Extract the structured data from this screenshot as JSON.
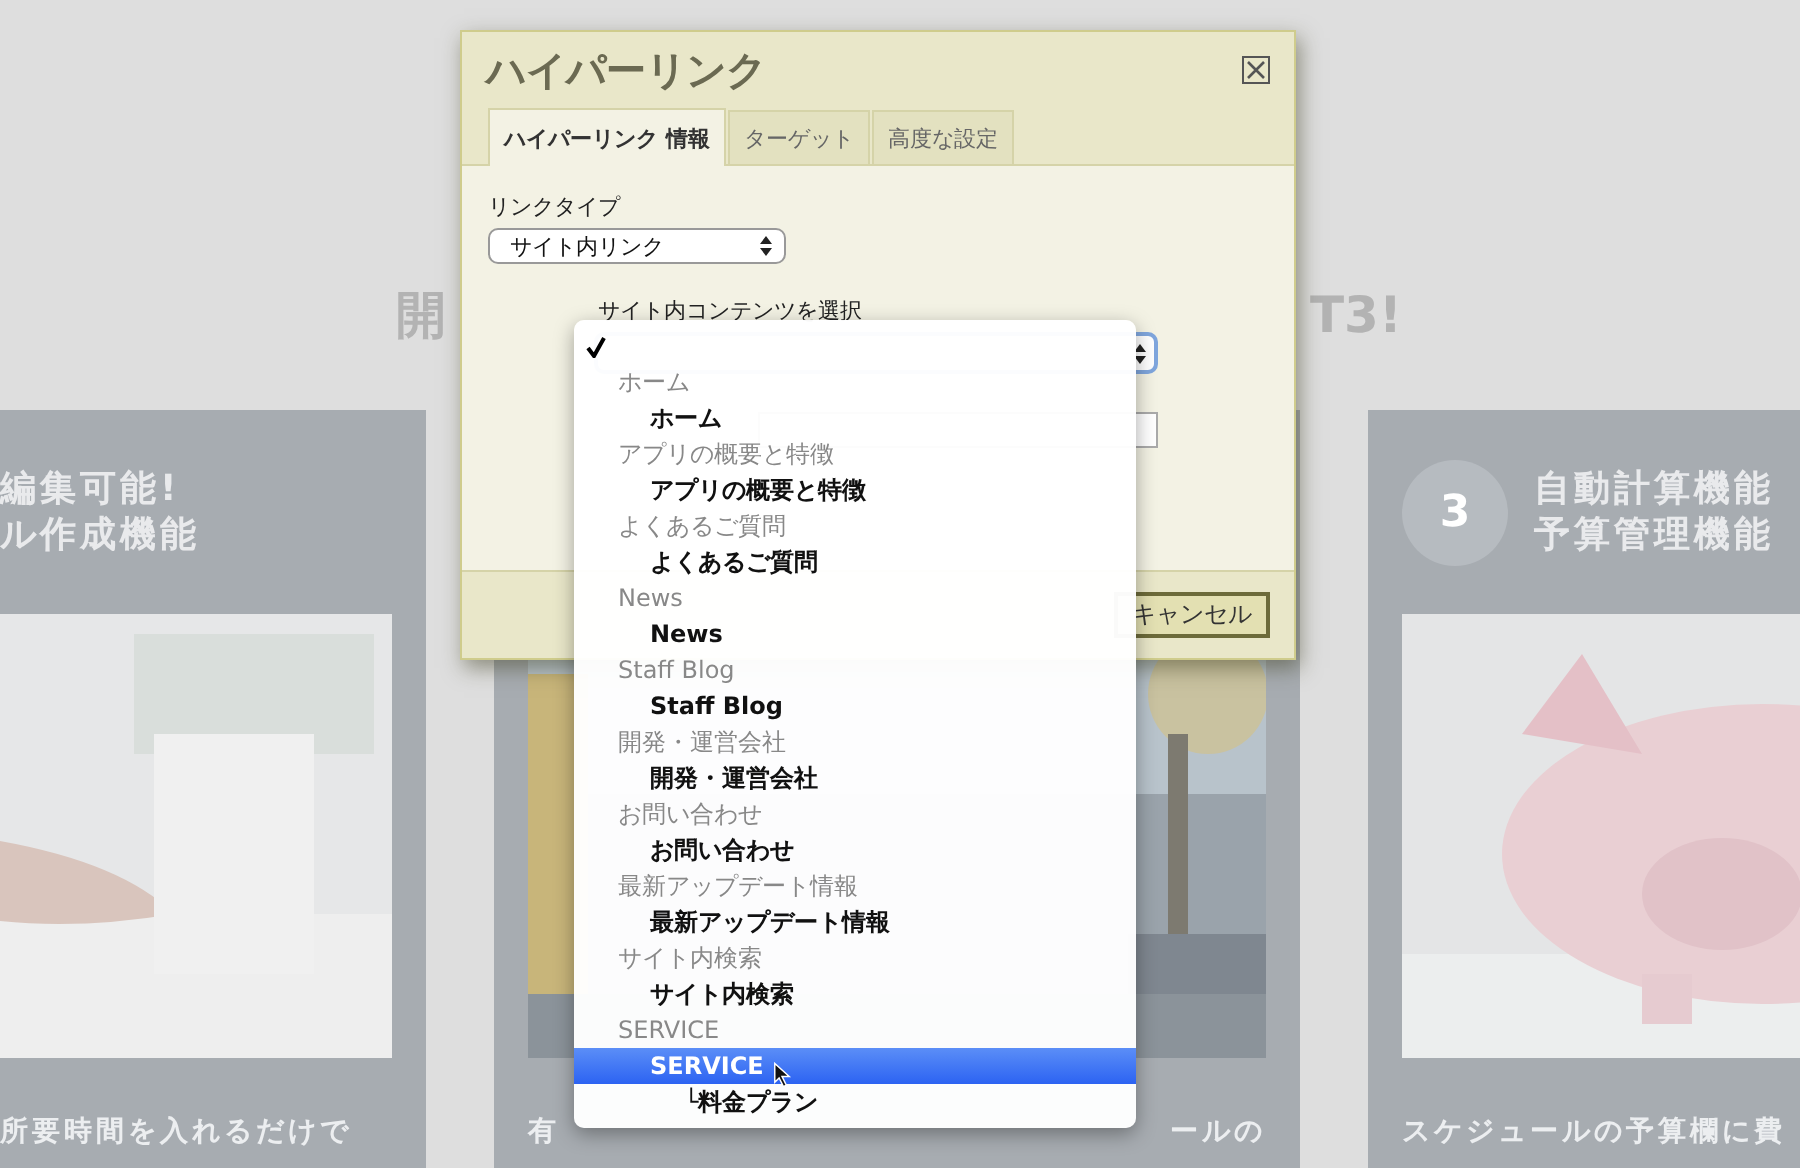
{
  "background": {
    "heading_fragments": [
      "開",
      "T3!"
    ],
    "cards": [
      {
        "title_lines": [
          "編集可能!",
          "ル作成機能"
        ],
        "picture": {
          "kind": "picture"
        },
        "caption": [
          "所要時間を入れるだけで"
        ]
      },
      {
        "picture": {
          "kind": "picture"
        },
        "caption": [
          "有",
          "ールの"
        ]
      },
      {
        "number": "3",
        "title_lines": [
          "自動計算機能",
          "予算管理機能"
        ],
        "picture": {
          "kind": "picture"
        },
        "caption": [
          "スケジュールの予算欄に費"
        ]
      }
    ]
  },
  "dialog": {
    "title": "ハイパーリンク",
    "tabs": [
      {
        "label": "ハイパーリンク 情報",
        "selected": true
      },
      {
        "label": "ターゲット",
        "selected": false
      },
      {
        "label": "高度な設定",
        "selected": false
      }
    ],
    "link_type": {
      "label": "リンクタイプ",
      "value": "サイト内リンク"
    },
    "content_select": {
      "label": "サイト内コンテンツを選択"
    },
    "buttons": [
      {
        "label": "キャンセル"
      }
    ]
  },
  "dropdown": {
    "blank_option": {
      "checked": true
    },
    "groups": [
      {
        "label": "ホーム",
        "options": [
          {
            "label": "ホーム",
            "highlighted": false
          }
        ]
      },
      {
        "label": "アプリの概要と特徴",
        "options": [
          {
            "label": "アプリの概要と特徴",
            "highlighted": false
          }
        ]
      },
      {
        "label": "よくあるご質問",
        "options": [
          {
            "label": "よくあるご質問",
            "highlighted": false
          }
        ]
      },
      {
        "label": "News",
        "options": [
          {
            "label": "News",
            "highlighted": false
          }
        ]
      },
      {
        "label": "Staff Blog",
        "options": [
          {
            "label": "Staff Blog",
            "highlighted": false
          }
        ]
      },
      {
        "label": "開発・運営会社",
        "options": [
          {
            "label": "開発・運営会社",
            "highlighted": false
          }
        ]
      },
      {
        "label": "お問い合わせ",
        "options": [
          {
            "label": "お問い合わせ",
            "highlighted": false
          }
        ]
      },
      {
        "label": "最新アップデート情報",
        "options": [
          {
            "label": "最新アップデート情報",
            "highlighted": false
          }
        ]
      },
      {
        "label": "サイト内検索",
        "options": [
          {
            "label": "サイト内検索",
            "highlighted": false
          }
        ]
      },
      {
        "label": "SERVICE",
        "options": [
          {
            "label": "SERVICE",
            "highlighted": true,
            "children": [
              {
                "label": "└料金プラン",
                "highlighted": false
              }
            ]
          }
        ]
      }
    ]
  }
}
